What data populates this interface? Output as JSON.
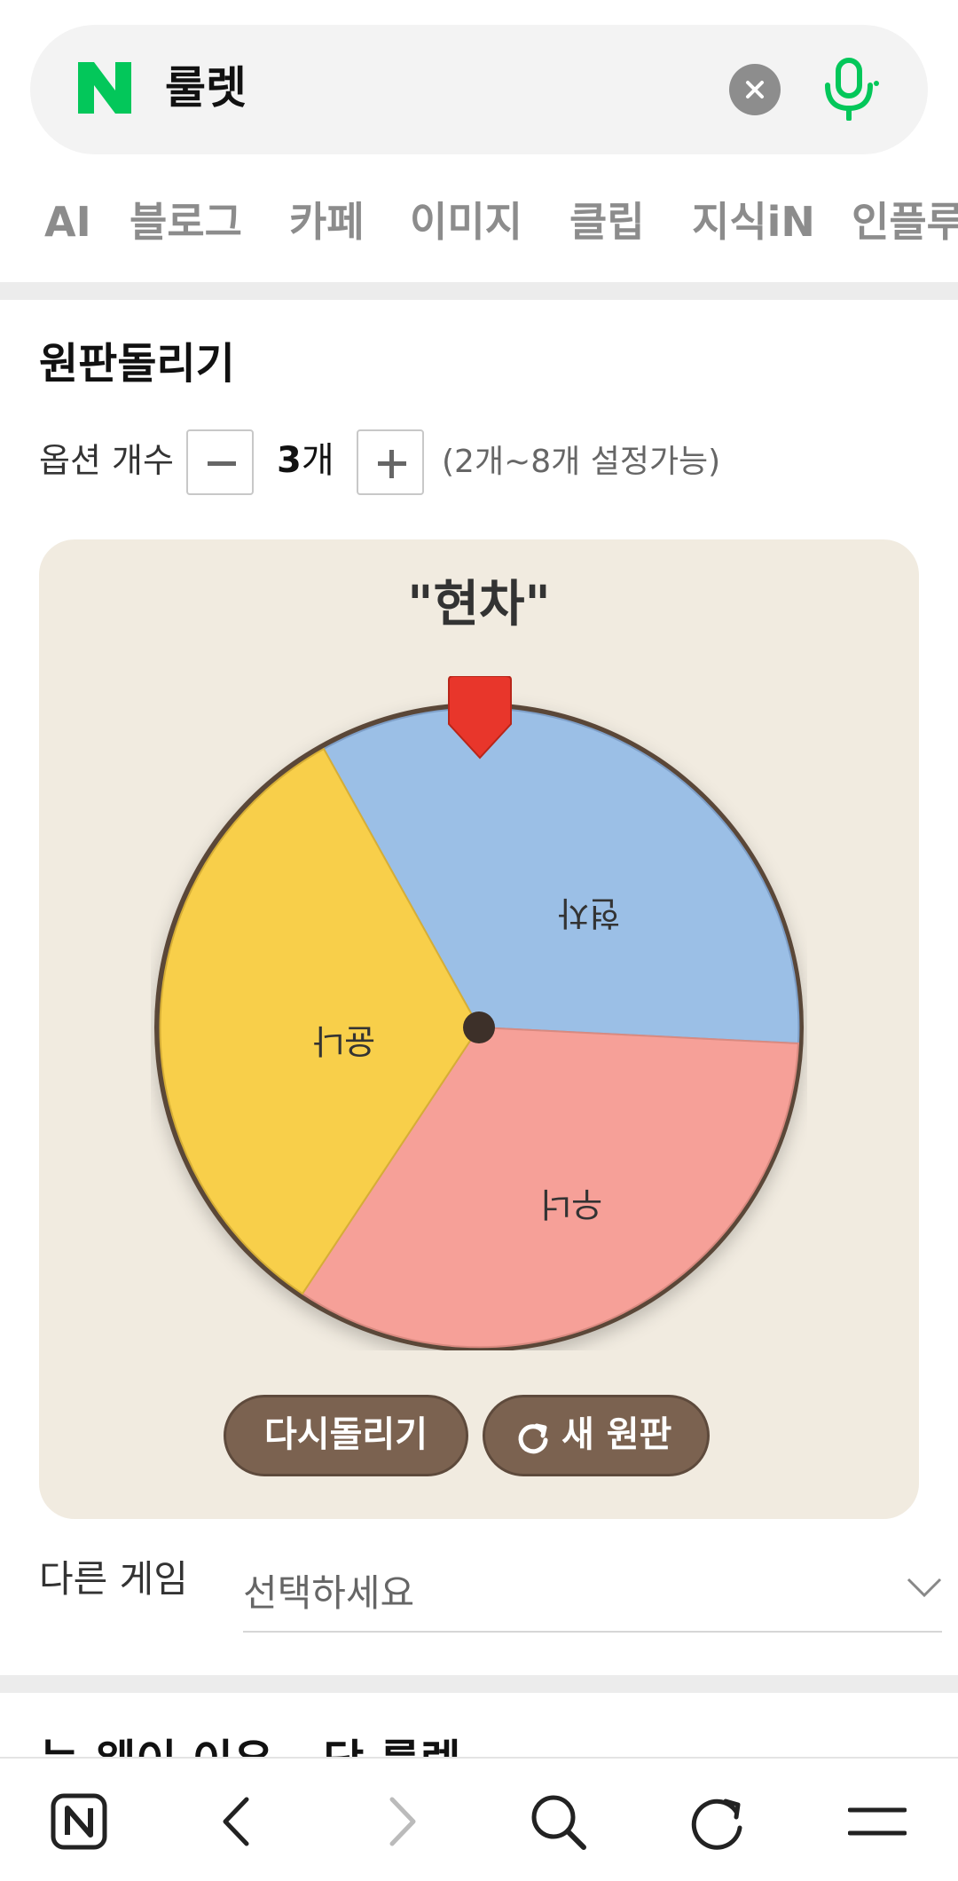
{
  "search": {
    "query": "룰렛"
  },
  "tabs": [
    "AI",
    "블로그",
    "카페",
    "이미지",
    "클립",
    "지식iN",
    "인플루"
  ],
  "widget": {
    "title": "원판돌리기",
    "option_label": "옵션 개수",
    "count_value": "3",
    "count_unit": "개",
    "range_hint": "(2개~8개 설정가능)",
    "result": "\"현차\"",
    "segments": [
      {
        "label": "현차",
        "color": "#9bbfe6"
      },
      {
        "label": "우너",
        "color": "#f6a098"
      },
      {
        "label": "윤나",
        "color": "#f8cf4a"
      }
    ],
    "respin_label": "다시돌리기",
    "new_label": "새 원판"
  },
  "other_game": {
    "label": "다른 게임",
    "placeholder": "선택하세요"
  },
  "next_section_title": "능 웨이 이유 - 당 룰렛",
  "bottom_nav": [
    "home-icon",
    "back-icon",
    "forward-icon",
    "search-icon",
    "refresh-icon",
    "menu-icon"
  ],
  "colors": {
    "naver_green": "#03c75a",
    "accent_red": "#e8362b",
    "wheel_rim": "#5a4638"
  }
}
